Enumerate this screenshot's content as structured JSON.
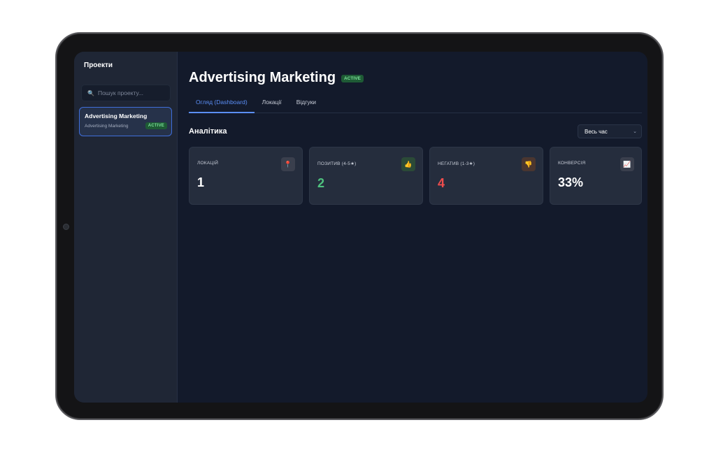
{
  "sidebar": {
    "title": "Проекти",
    "search_placeholder": "Пошук проекту...",
    "projects": [
      {
        "name": "Advertising Marketing",
        "subtitle": "Advertising Marketing",
        "status": "ACTIVE"
      }
    ]
  },
  "header": {
    "title": "Advertising Marketing",
    "status": "ACTIVE"
  },
  "tabs": [
    {
      "label": "Огляд (Dashboard)",
      "active": true
    },
    {
      "label": "Локації",
      "active": false
    },
    {
      "label": "Відгуки",
      "active": false
    }
  ],
  "analytics": {
    "title": "Аналітика",
    "period": "Весь час",
    "cards": [
      {
        "label": "ЛОКАЦІЙ",
        "value": "1",
        "icon": "pin-icon"
      },
      {
        "label": "ПОЗИТИВ (4-5★)",
        "value": "2",
        "icon": "thumbs-up-icon"
      },
      {
        "label": "НЕГАТИВ (1-3★)",
        "value": "4",
        "icon": "thumbs-down-icon"
      },
      {
        "label": "КОНВЕРСІЯ",
        "value": "33%",
        "icon": "chart-icon"
      }
    ]
  },
  "colors": {
    "accent": "#5b8ff7",
    "positive": "#4fc27f",
    "negative": "#ef4d4d",
    "active_badge": "#1e5b35"
  }
}
